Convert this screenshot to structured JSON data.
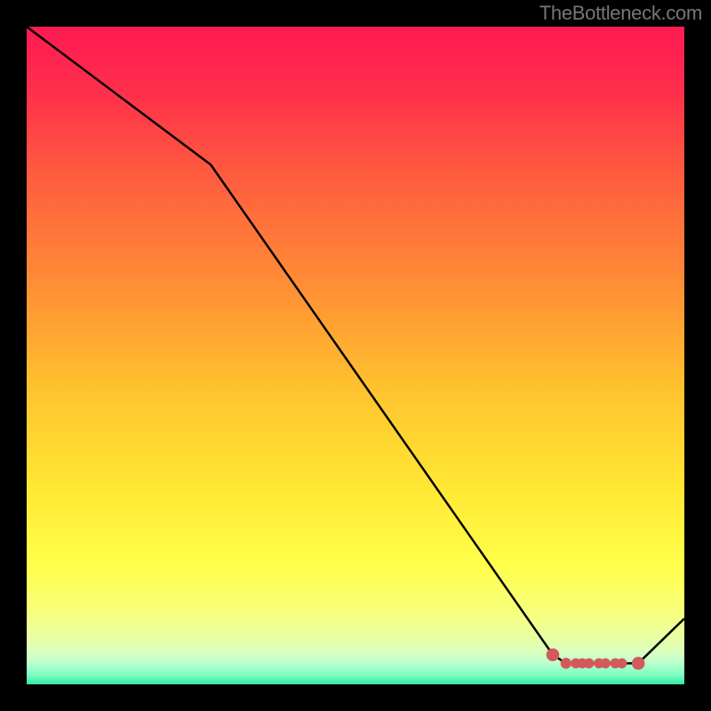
{
  "attribution": "TheBottleneck.com",
  "chart_data": {
    "type": "line",
    "title": "",
    "xlabel": "",
    "ylabel": "",
    "xlim": [
      0,
      100
    ],
    "ylim": [
      0,
      100
    ],
    "grid": false,
    "legend": false,
    "x": [
      0,
      28,
      80,
      82,
      83.5,
      84.5,
      85.5,
      87,
      88,
      89.5,
      90.5,
      93,
      100
    ],
    "values": [
      100,
      79,
      4.5,
      3.2,
      3.2,
      3.2,
      3.2,
      3.2,
      3.2,
      3.2,
      3.2,
      3.2,
      10
    ],
    "markers_x": [
      80,
      82,
      83.5,
      84.5,
      85.5,
      87,
      88,
      89.5,
      90.5,
      93
    ],
    "markers_y": [
      4.5,
      3.2,
      3.2,
      3.2,
      3.2,
      3.2,
      3.2,
      3.2,
      3.2,
      3.2
    ],
    "markers_r": [
      3.3,
      2.8,
      2.6,
      2.6,
      2.6,
      2.6,
      2.6,
      2.6,
      2.6,
      3.3
    ],
    "marker_color": "#d25a5a",
    "line_color": "#000000",
    "gradient_stops": [
      {
        "offset": 0.0,
        "color": "#ff1a53"
      },
      {
        "offset": 0.1,
        "color": "#ff2f4b"
      },
      {
        "offset": 0.22,
        "color": "#ff5a3f"
      },
      {
        "offset": 0.38,
        "color": "#ff8a36"
      },
      {
        "offset": 0.55,
        "color": "#ffc22e"
      },
      {
        "offset": 0.7,
        "color": "#ffe733"
      },
      {
        "offset": 0.82,
        "color": "#ffff4a"
      },
      {
        "offset": 0.9,
        "color": "#f5ff84"
      },
      {
        "offset": 0.945,
        "color": "#dfffb6"
      },
      {
        "offset": 0.965,
        "color": "#c3ffce"
      },
      {
        "offset": 0.985,
        "color": "#7dffc2"
      },
      {
        "offset": 1.0,
        "color": "#34e8a5"
      }
    ]
  }
}
